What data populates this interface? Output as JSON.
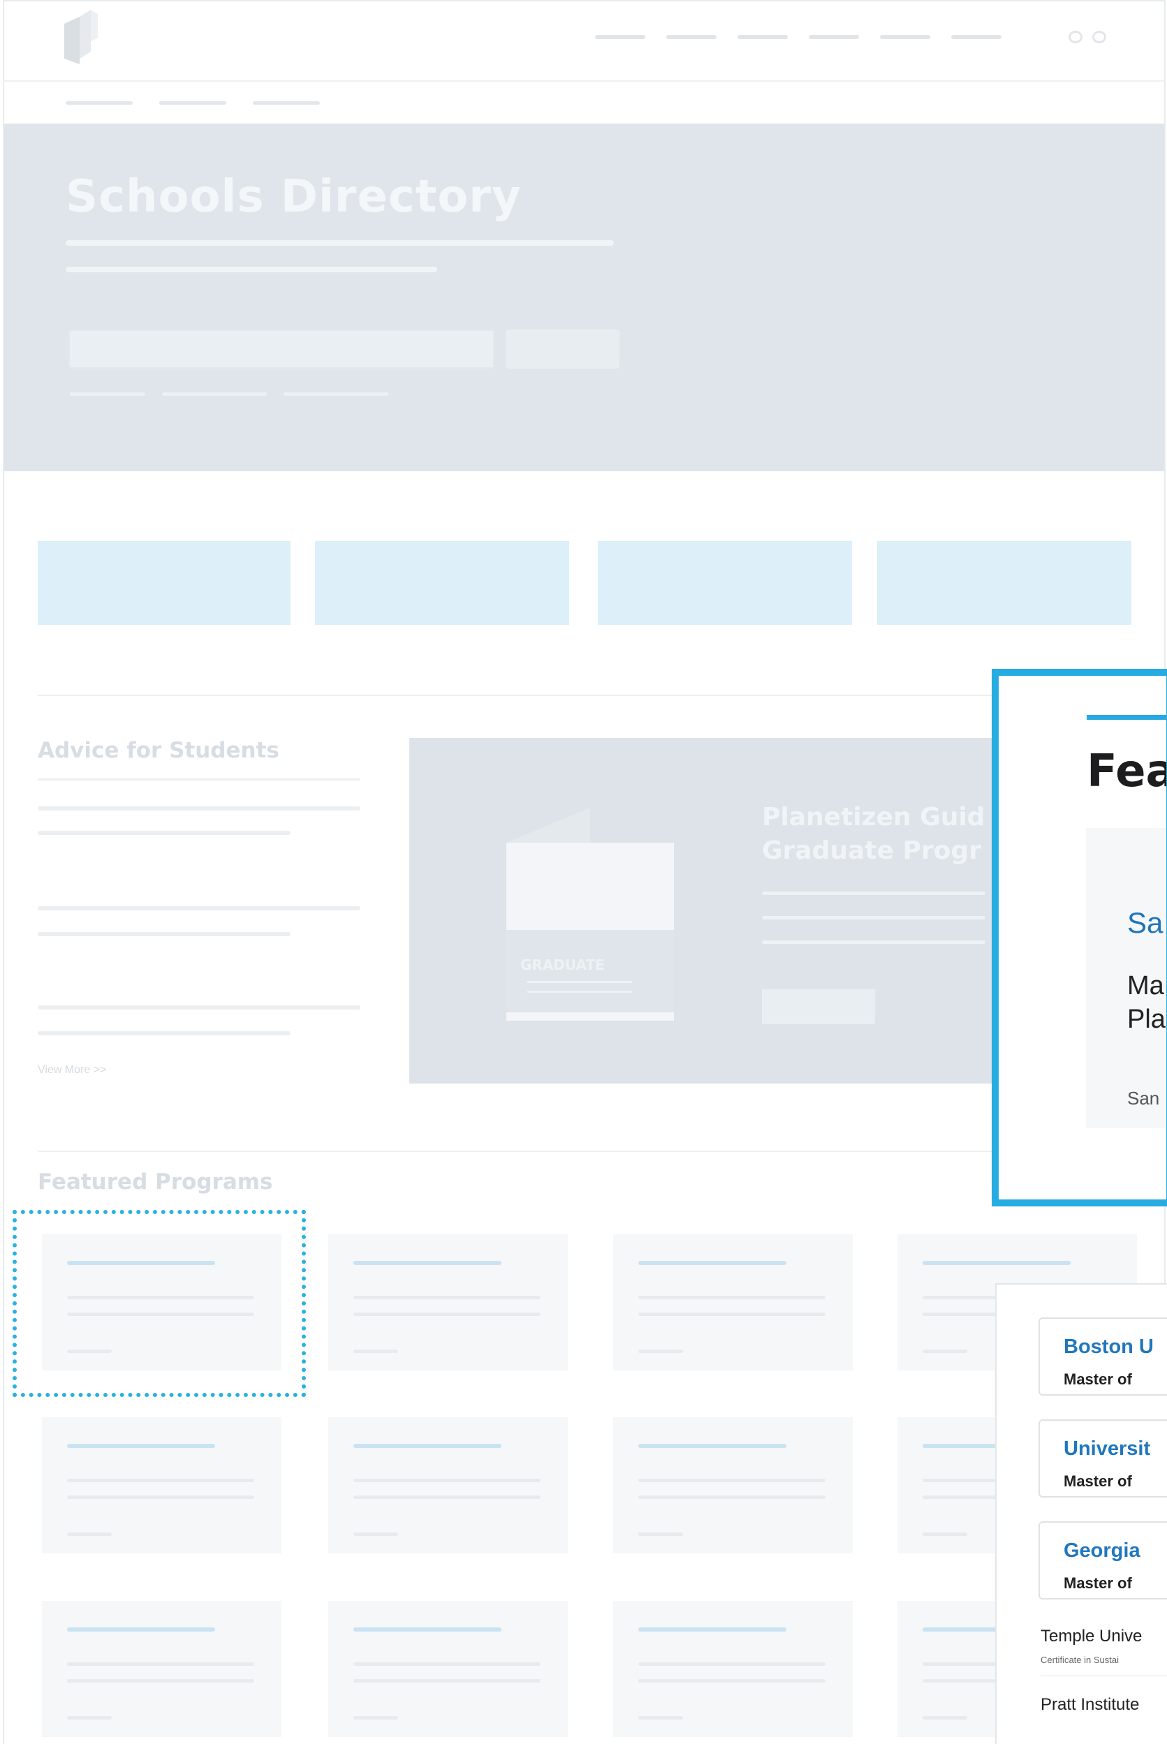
{
  "hero": {
    "title": "Schools Directory"
  },
  "advice": {
    "heading": "Advice for Students",
    "view_more": "View More >>"
  },
  "promo": {
    "title_line1": "Planetizen Guid",
    "title_line2": "Graduate Progr",
    "book_label": "GRADUATE"
  },
  "featured": {
    "heading": "Featured Programs"
  },
  "zoom_callout": {
    "heading": "Fea",
    "school": "Sa",
    "program_line1": "Ma",
    "program_line2": "Pla",
    "location": "San"
  },
  "program_list": {
    "cards": [
      {
        "school": "Boston U",
        "degree": "Master of"
      },
      {
        "school": "Universit",
        "degree": "Master of"
      },
      {
        "school": "Georgia",
        "degree": "Master of"
      }
    ],
    "plain": [
      {
        "school": "Temple Unive",
        "degree": "Certificate in Sustai"
      },
      {
        "school": "Pratt Institute",
        "degree": ""
      }
    ]
  },
  "colors": {
    "accent": "#26ace0",
    "link": "#1f77bf",
    "hero_bg": "#dfe5ea",
    "tile_bg": "#ddeff9"
  }
}
